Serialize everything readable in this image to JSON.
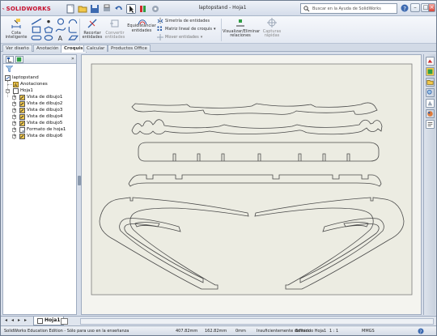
{
  "app": {
    "brand": "SOLIDWORKS",
    "document_title": "laptopstand - Hoja1",
    "help_search_placeholder": "Buscar en la Ayuda de SolidWorks"
  },
  "ribbon": {
    "cota_label_1": "Cota",
    "cota_label_2": "inteligente",
    "recortar_label_1": "Recortar",
    "recortar_label_2": "entidades",
    "convertir_label_1": "Convertir",
    "convertir_label_2": "entidades",
    "equidistanciar_label_1": "Equidistanciar",
    "equidistanciar_label_2": "entidades",
    "simetria_label": "Simetría de entidades",
    "matriz_label": "Matriz lineal de croquis",
    "mover_label": "Mover entidades",
    "visualizar_label_1": "Visualizar/Eliminar",
    "visualizar_label_2": "relaciones",
    "capturas_label_1": "Capturas",
    "capturas_label_2": "rápidas"
  },
  "tabs": [
    {
      "label": "Ver diseño"
    },
    {
      "label": "Anotación"
    },
    {
      "label": "Croquis"
    },
    {
      "label": "Calcular"
    },
    {
      "label": "Productos Office"
    }
  ],
  "active_tab": "Croquis",
  "tree": {
    "root": "laptopstand",
    "annotations": "Anotaciones",
    "sheet": "Hoja1",
    "views": [
      "Vista de dibujo1",
      "Vista de dibujo2",
      "Vista de dibujo3",
      "Vista de dibujo4",
      "Vista de dibujo5"
    ],
    "sheet_format": "Formato de hoja1",
    "view6": "Vista de dibujo6"
  },
  "sheet_tab": {
    "label": "Hoja1"
  },
  "status": {
    "edition": "SolidWorks Education Edition - Sólo para uso en la enseñanza",
    "x": "407.82mm",
    "y": "162.82mm",
    "z": "0mm",
    "definition": "Insuficientemente definido",
    "editing": "Editando Hoja1",
    "scale": "1 : 1",
    "units": "MMGS"
  },
  "colors": {
    "sheet_background": "#ecece2",
    "outline": "#4a4a4a",
    "brand_red": "#c8102e"
  }
}
